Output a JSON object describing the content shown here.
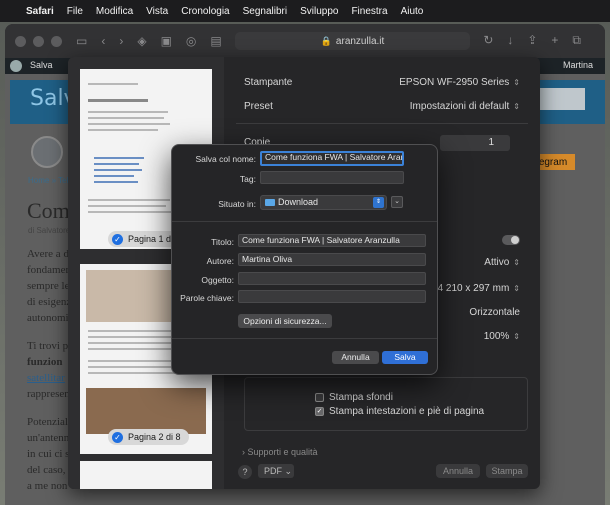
{
  "menubar": {
    "items": [
      "Safari",
      "File",
      "Modifica",
      "Vista",
      "Cronologia",
      "Segnalibri",
      "Sviluppo",
      "Finestra",
      "Aiuto"
    ]
  },
  "browser": {
    "url": "aranzulla.it"
  },
  "website": {
    "admin_site": "Salva",
    "admin_user": "Martina",
    "logo_text": "Salva",
    "telegram_label": "egram",
    "breadcrumb": "Home » Tele",
    "title_fragment": "Come",
    "byline_fragment": "di Salvatore",
    "para_lines": [
      "Avere a d",
      "fondamer",
      "sempre le",
      "di esigenz",
      "autonomi",
      "",
      "Ti trovi p",
      "funzion",
      "satellitar",
      "rappresen",
      "",
      "Potenzial",
      "un'antenn",
      "in cui ci s",
      "del caso,",
      "a me non"
    ]
  },
  "print": {
    "rows": [
      {
        "label": "Stampante",
        "value": "EPSON WF-2950 Series"
      },
      {
        "label": "Preset",
        "value": "Impostazioni di default"
      },
      {
        "label": "Copie",
        "value": "1"
      },
      {
        "label": "",
        "value": "Attivo"
      },
      {
        "label": "",
        "value": "A4  210 x 297 mm"
      },
      {
        "label": "",
        "value": "Orizzontale"
      },
      {
        "label": "",
        "value": "100%"
      }
    ],
    "page_badges": [
      "Pagina 1 di 8",
      "Pagina 2 di 8"
    ],
    "options": [
      {
        "label": "Stampa sfondi",
        "checked": false
      },
      {
        "label": "Stampa intestazioni e piè di pagina",
        "checked": true
      }
    ],
    "supporti": "Supporti e qualità",
    "help": "?",
    "pdf": "PDF",
    "cancel": "Annulla",
    "print_button": "Stampa"
  },
  "dialog": {
    "save_as_label": "Salva col nome:",
    "save_as_value": "Come funziona FWA | Salvatore Aranzulla",
    "tags_label": "Tag:",
    "location_label": "Situato in:",
    "location_value": "Download",
    "title_label": "Titolo:",
    "title_value": "Come funziona FWA | Salvatore Aranzulla",
    "author_label": "Autore:",
    "author_value": "Martina Oliva",
    "subject_label": "Oggetto:",
    "keywords_label": "Parole chiave:",
    "security_button": "Opzioni di sicurezza...",
    "cancel_button": "Annulla",
    "save_button": "Salva"
  }
}
